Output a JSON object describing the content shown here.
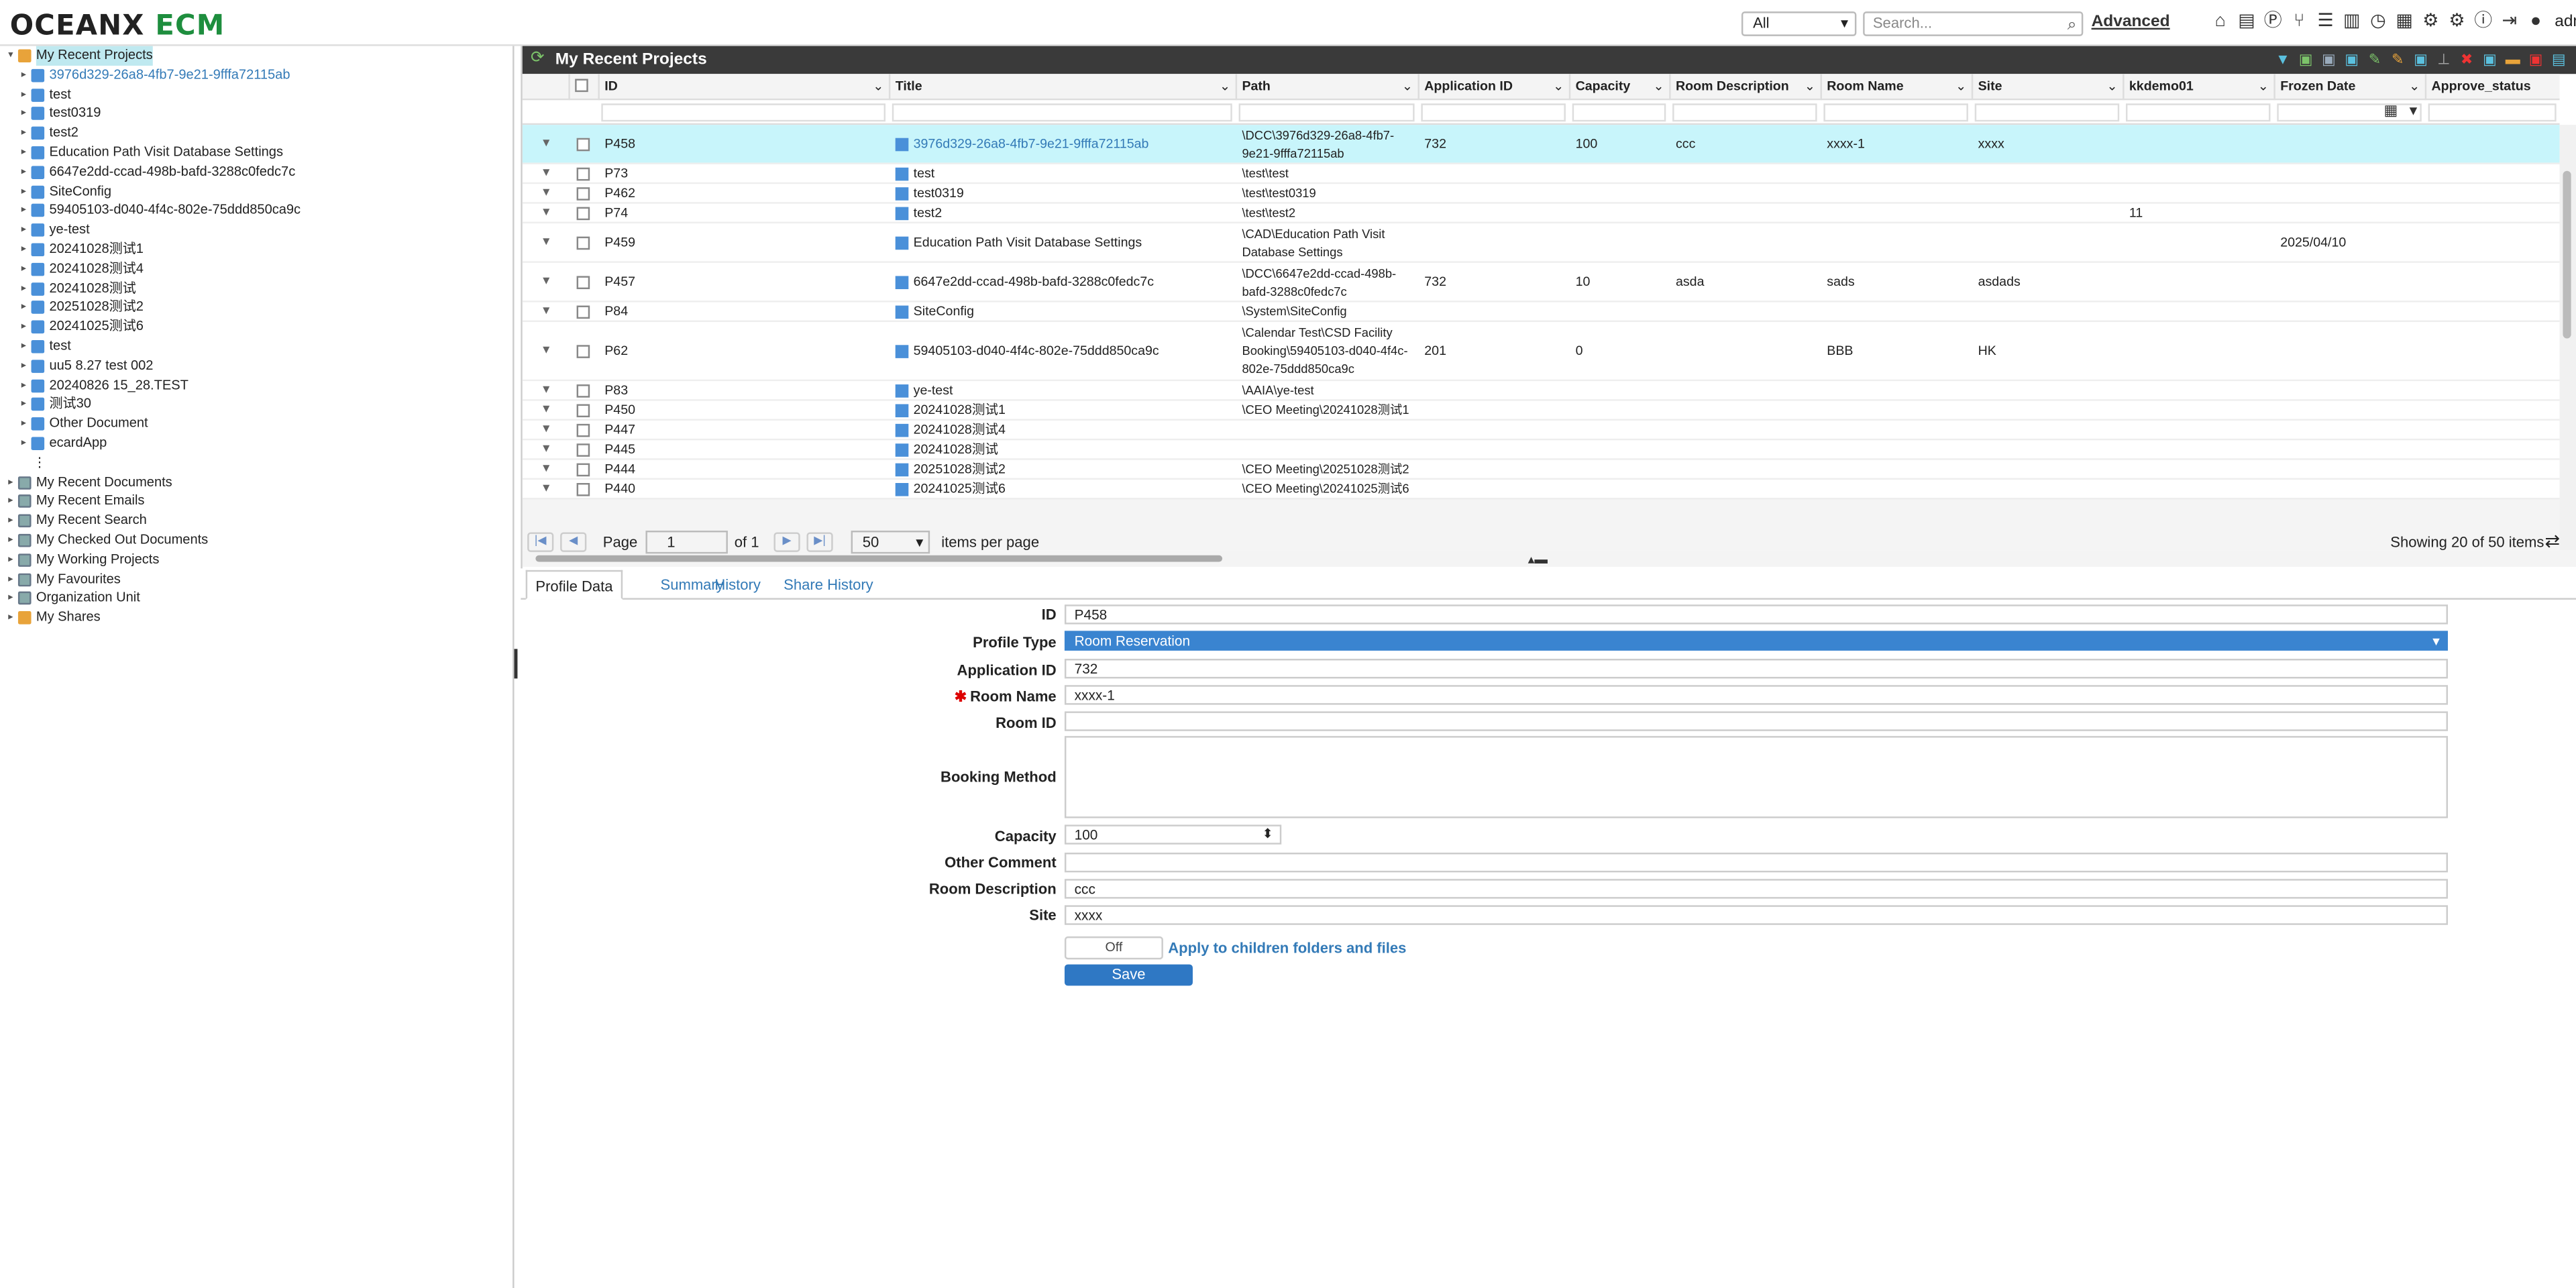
{
  "app": {
    "logo_part1": "OCEANX",
    "logo_part2": "ECM",
    "scope": "All",
    "search_placeholder": "Search...",
    "advanced": "Advanced",
    "user": "admin"
  },
  "tree": {
    "root": "My Recent Projects",
    "children": [
      "3976d329-26a8-4fb7-9e21-9fffa72115ab",
      "test",
      "test0319",
      "test2",
      "Education Path Visit Database Settings",
      "6647e2dd-ccad-498b-bafd-3288c0fedc7c",
      "SiteConfig",
      "59405103-d040-4f4c-802e-75ddd850ca9c",
      "ye-test",
      "20241028测试1",
      "20241028测试4",
      "20241028测试",
      "20251028测试2",
      "20241025测试6",
      "test",
      "uu5 8.27 test 002",
      "20240826 15_28.TEST",
      "测试30",
      "Other Document",
      "ecardApp"
    ],
    "more": "⋮",
    "sections": [
      "My Recent Documents",
      "My Recent Emails",
      "My Recent Search",
      "My Checked Out Documents",
      "My Working Projects",
      "My Favourites",
      "Organization Unit",
      "My Shares"
    ]
  },
  "grid": {
    "title": "My Recent Projects",
    "columns": [
      "ID",
      "Title",
      "Path",
      "Application ID",
      "Capacity",
      "Room Description",
      "Room Name",
      "Site",
      "kkdemo01",
      "Frozen Date",
      "Approve_status"
    ],
    "rows": [
      {
        "id": "P458",
        "title": "3976d329-26a8-4fb7-9e21-9fffa72115ab",
        "path": "\\DCC\\3976d329-26a8-4fb7-9e21-9fffa72115ab",
        "app": "732",
        "cap": "100",
        "rdesc": "ccc",
        "rname": "xxxx-1",
        "site": "xxxx",
        "kk": "",
        "fd": "",
        "as": ""
      },
      {
        "id": "P73",
        "title": "test",
        "path": "\\test\\test",
        "app": "",
        "cap": "",
        "rdesc": "",
        "rname": "",
        "site": "",
        "kk": "",
        "fd": "",
        "as": ""
      },
      {
        "id": "P462",
        "title": "test0319",
        "path": "\\test\\test0319",
        "app": "",
        "cap": "",
        "rdesc": "",
        "rname": "",
        "site": "",
        "kk": "",
        "fd": "",
        "as": ""
      },
      {
        "id": "P74",
        "title": "test2",
        "path": "\\test\\test2",
        "app": "",
        "cap": "",
        "rdesc": "",
        "rname": "",
        "site": "",
        "kk": "11",
        "fd": "",
        "as": ""
      },
      {
        "id": "P459",
        "title": "Education Path Visit Database Settings",
        "path": "\\CAD\\Education Path Visit Database Settings",
        "app": "",
        "cap": "",
        "rdesc": "",
        "rname": "",
        "site": "",
        "kk": "",
        "fd": "2025/04/10",
        "as": ""
      },
      {
        "id": "P457",
        "title": "6647e2dd-ccad-498b-bafd-3288c0fedc7c",
        "path": "\\DCC\\6647e2dd-ccad-498b-bafd-3288c0fedc7c",
        "app": "732",
        "cap": "10",
        "rdesc": "asda",
        "rname": "sads",
        "site": "asdads",
        "kk": "",
        "fd": "",
        "as": ""
      },
      {
        "id": "P84",
        "title": "SiteConfig",
        "path": "\\System\\SiteConfig",
        "app": "",
        "cap": "",
        "rdesc": "",
        "rname": "",
        "site": "",
        "kk": "",
        "fd": "",
        "as": ""
      },
      {
        "id": "P62",
        "title": "59405103-d040-4f4c-802e-75ddd850ca9c",
        "path": "\\Calendar Test\\CSD Facility Booking\\59405103-d040-4f4c-802e-75ddd850ca9c",
        "app": "201",
        "cap": "0",
        "rdesc": "",
        "rname": "BBB",
        "site": "HK",
        "kk": "",
        "fd": "",
        "as": ""
      },
      {
        "id": "P83",
        "title": "ye-test",
        "path": "\\AAIA\\ye-test",
        "app": "",
        "cap": "",
        "rdesc": "",
        "rname": "",
        "site": "",
        "kk": "",
        "fd": "",
        "as": ""
      },
      {
        "id": "P450",
        "title": "20241028测试1",
        "path": "\\CEO Meeting\\20241028测试1",
        "app": "",
        "cap": "",
        "rdesc": "",
        "rname": "",
        "site": "",
        "kk": "",
        "fd": "",
        "as": ""
      },
      {
        "id": "P447",
        "title": "20241028测试4",
        "path": "",
        "app": "",
        "cap": "",
        "rdesc": "",
        "rname": "",
        "site": "",
        "kk": "",
        "fd": "",
        "as": ""
      },
      {
        "id": "P445",
        "title": "20241028测试",
        "path": "",
        "app": "",
        "cap": "",
        "rdesc": "",
        "rname": "",
        "site": "",
        "kk": "",
        "fd": "",
        "as": ""
      },
      {
        "id": "P444",
        "title": "20251028测试2",
        "path": "\\CEO Meeting\\20251028测试2",
        "app": "",
        "cap": "",
        "rdesc": "",
        "rname": "",
        "site": "",
        "kk": "",
        "fd": "",
        "as": ""
      },
      {
        "id": "P440",
        "title": "20241025测试6",
        "path": "\\CEO Meeting\\20241025测试6",
        "app": "",
        "cap": "",
        "rdesc": "",
        "rname": "",
        "site": "",
        "kk": "",
        "fd": "",
        "as": ""
      }
    ]
  },
  "pager": {
    "page_label": "Page",
    "page": "1",
    "of": "of 1",
    "per_page": "50",
    "items_label": "items per page",
    "showing": "Showing 20 of 50 items"
  },
  "tabs": [
    "Profile Data",
    "Summary",
    "History",
    "Share History"
  ],
  "form": {
    "id_label": "ID",
    "id": "P458",
    "ptype_label": "Profile Type",
    "ptype": "Room Reservation",
    "app_label": "Application ID",
    "app": "732",
    "rname_label": "Room Name",
    "rname": "xxxx-1",
    "rid_label": "Room ID",
    "rid": "",
    "bm_label": "Booking Method",
    "bm": "",
    "cap_label": "Capacity",
    "cap": "100",
    "oc_label": "Other Comment",
    "oc": "",
    "rdesc_label": "Room Description",
    "rdesc": "ccc",
    "site_label": "Site",
    "site": "xxxx",
    "toggle": "Off",
    "apply": "Apply to children folders and files",
    "save": "Save"
  },
  "colors": {
    "header_bg": "#3a3a3a",
    "highlight": "#c8f5fb",
    "accent": "#337ab7",
    "save": "#2f78c4"
  }
}
